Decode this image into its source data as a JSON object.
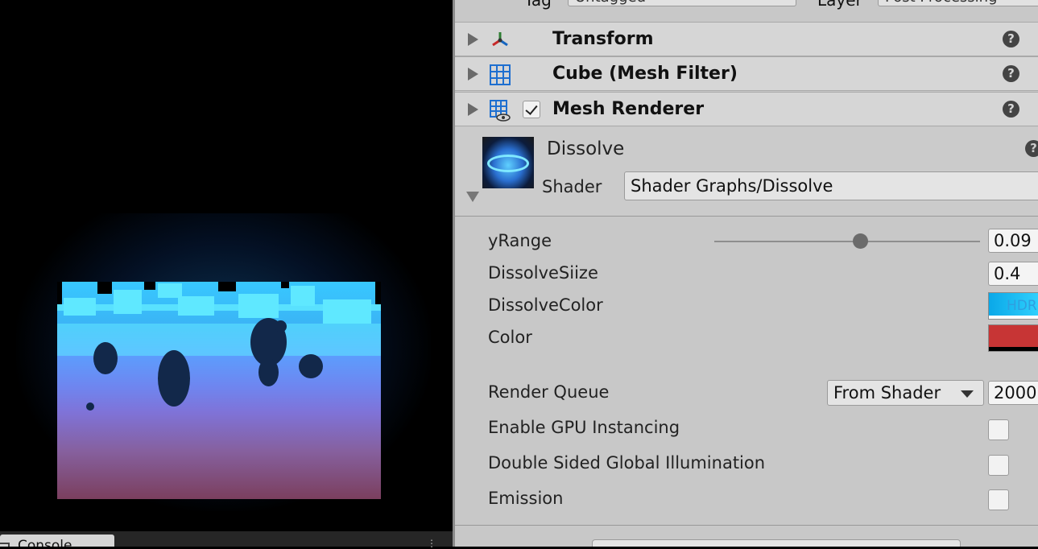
{
  "scene": {
    "bottom_tab": {
      "label": "Console"
    },
    "tab_menu": "⋮"
  },
  "inspector": {
    "tag_row": {
      "tag_label": "Tag",
      "tag_value": "Untagged",
      "layer_label": "Layer",
      "layer_value": "Post Processing"
    },
    "components": [
      {
        "title": "Transform",
        "icon": "transform-icon"
      },
      {
        "title": "Cube (Mesh Filter)",
        "icon": "mesh-filter-icon"
      },
      {
        "title": "Mesh Renderer",
        "icon": "mesh-renderer-icon",
        "enabled": true
      }
    ],
    "help_glyph": "?",
    "more_glyph": "⋮",
    "material": {
      "name": "Dissolve",
      "shader_label": "Shader",
      "shader_value": "Shader Graphs/Dissolve"
    },
    "properties": {
      "yrange": {
        "label": "yRange",
        "value": "0.09",
        "slider_fraction": 0.55
      },
      "dissolve_size": {
        "label": "DissolveSiize",
        "value": "0.4"
      },
      "dissolve_color": {
        "label": "DissolveColor",
        "badge": "HDR",
        "color": "#1ab8f0"
      },
      "color": {
        "label": "Color",
        "color": "#c73535"
      },
      "render_queue": {
        "label": "Render Queue",
        "mode": "From Shader",
        "value": "2000"
      },
      "gpu_instancing": {
        "label": "Enable GPU Instancing",
        "checked": false
      },
      "double_sided_gi": {
        "label": "Double Sided Global Illumination",
        "checked": false
      },
      "emission": {
        "label": "Emission",
        "checked": false
      }
    }
  }
}
